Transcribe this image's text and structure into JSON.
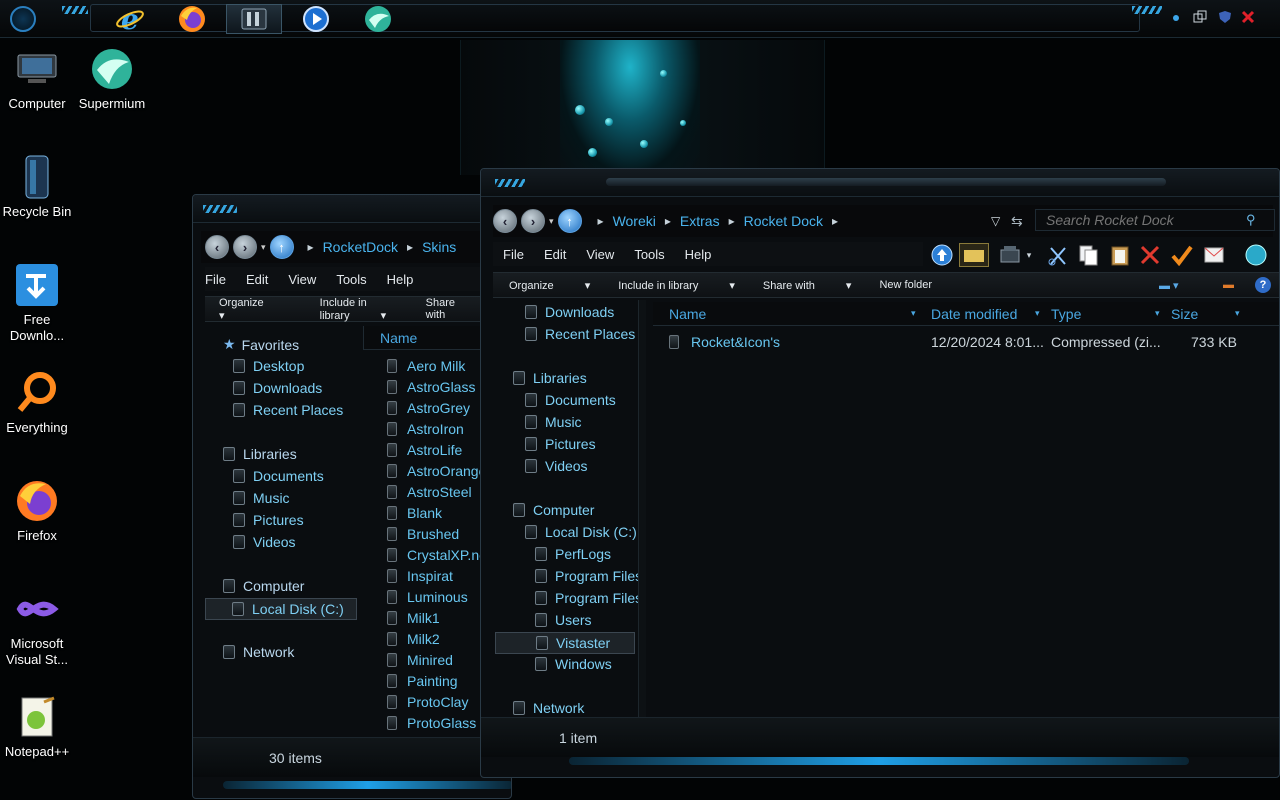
{
  "taskbar": {
    "pinned": [
      {
        "name": "Internet Explorer",
        "icon": "ie-icon"
      },
      {
        "name": "Firefox",
        "icon": "firefox-icon"
      },
      {
        "name": "Windows Explorer",
        "icon": "explorer-icon"
      },
      {
        "name": "Media Player",
        "icon": "media-player-icon"
      },
      {
        "name": "Supermium",
        "icon": "supermium-icon"
      }
    ]
  },
  "desktop": {
    "icons": [
      {
        "label": "Computer",
        "icon": "computer-icon"
      },
      {
        "label": "Supermium",
        "icon": "supermium-icon"
      },
      {
        "label": "Recycle Bin",
        "icon": "recycle-bin-icon"
      },
      {
        "label": "Free Downlo...",
        "icon": "download-manager-icon"
      },
      {
        "label": "Everything",
        "icon": "everything-search-icon"
      },
      {
        "label": "Firefox",
        "icon": "firefox-icon"
      },
      {
        "label": "Microsoft Visual St...",
        "icon": "visual-studio-icon"
      },
      {
        "label": "Notepad++",
        "icon": "notepad-plus-plus-icon"
      }
    ]
  },
  "back_window": {
    "breadcrumb": [
      "RocketDock",
      "Skins"
    ],
    "menu": [
      "File",
      "Edit",
      "View",
      "Tools",
      "Help"
    ],
    "commands": [
      "Organize",
      "Include in library",
      "Share with"
    ],
    "nav": {
      "favorites_header": "Favorites",
      "favorites": [
        "Desktop",
        "Downloads",
        "Recent Places"
      ],
      "libraries_header": "Libraries",
      "libraries": [
        "Documents",
        "Music",
        "Pictures",
        "Videos"
      ],
      "computer_header": "Computer",
      "computer": [
        "Local Disk (C:)"
      ],
      "network_header": "Network"
    },
    "column_name": "Name",
    "files": [
      "Aero Milk",
      "AstroGlass",
      "AstroGrey",
      "AstroIron",
      "AstroLife",
      "AstroOrange",
      "AstroSteel",
      "Blank",
      "Brushed",
      "CrystalXP.net",
      "Inspirat",
      "Luminous",
      "Milk1",
      "Milk2",
      "Minired",
      "Painting",
      "ProtoClay",
      "ProtoGlass"
    ],
    "status": "30 items"
  },
  "front_window": {
    "breadcrumb": [
      "Woreki",
      "Extras",
      "Rocket Dock"
    ],
    "search_placeholder": "Search Rocket Dock",
    "menu": [
      "File",
      "Edit",
      "View",
      "Tools",
      "Help"
    ],
    "commands": [
      "Organize",
      "Include in library",
      "Share with",
      "New folder"
    ],
    "nav": {
      "top": [
        "Downloads",
        "Recent Places"
      ],
      "libraries_header": "Libraries",
      "libraries": [
        "Documents",
        "Music",
        "Pictures",
        "Videos"
      ],
      "computer_header": "Computer",
      "disk": "Local Disk (C:)",
      "folders": [
        "PerfLogs",
        "Program Files",
        "Program Files",
        "Users",
        "Vistaster",
        "Windows"
      ],
      "network_header": "Network"
    },
    "columns": {
      "name": "Name",
      "date": "Date modified",
      "type": "Type",
      "size": "Size"
    },
    "files": [
      {
        "name": "Rocket&Icon's",
        "date": "12/20/2024 8:01...",
        "type": "Compressed (zi...",
        "size": "733 KB"
      }
    ],
    "status": "1 item"
  },
  "colors": {
    "accent": "#4ab4ee",
    "link": "#68c6f0",
    "glow": "#1fb3c9"
  }
}
